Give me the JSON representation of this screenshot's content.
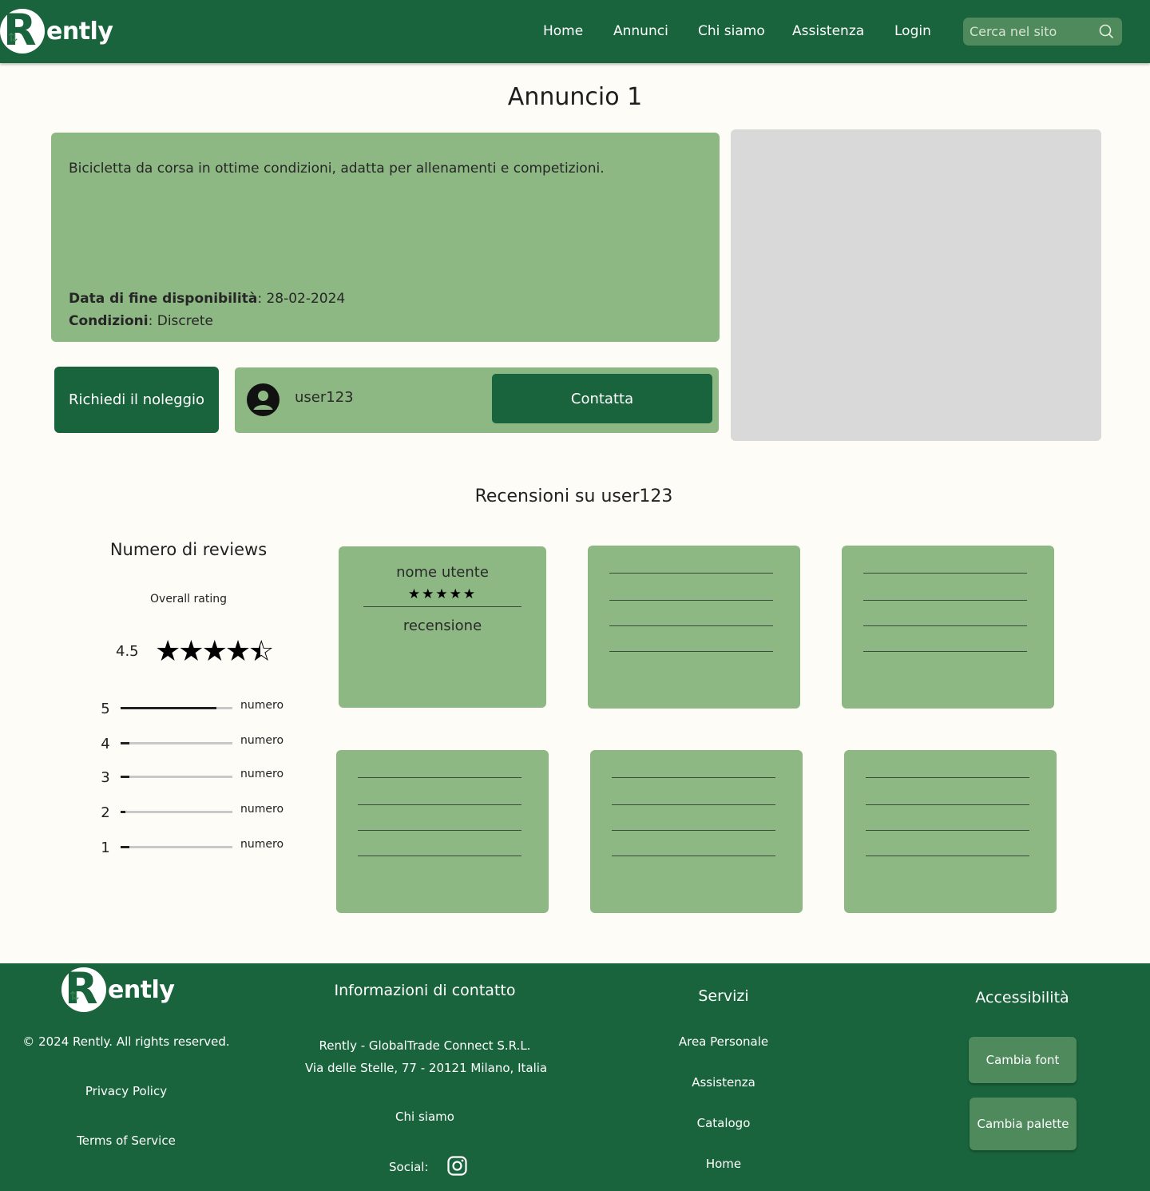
{
  "header": {
    "logo_text": "ently",
    "nav": [
      "Home",
      "Annunci",
      "Chi siamo",
      "Assistenza",
      "Login"
    ],
    "search_placeholder": "Cerca nel sito"
  },
  "listing": {
    "title": "Annuncio 1",
    "description": "Bicicletta da corsa in ottime condizioni, adatta per allenamenti e competizioni.",
    "end_date_label": "Data di fine disponibilità",
    "end_date_value": ": 28-02-2024",
    "condition_label": "Condizioni",
    "condition_value": ": Discrete",
    "rent_button": "Richiedi il noleggio",
    "owner_name": "user123",
    "contact_button": "Contatta"
  },
  "reviews": {
    "title": "Recensioni su user123",
    "stats_title": "Numero di reviews",
    "overall_label": "Overall rating",
    "average": "4.5",
    "average_value": 4.5,
    "bars": [
      {
        "stars": "5",
        "fraction": 0.86,
        "label": "numero"
      },
      {
        "stars": "4",
        "fraction": 0.08,
        "label": "numero"
      },
      {
        "stars": "3",
        "fraction": 0.08,
        "label": "numero"
      },
      {
        "stars": "2",
        "fraction": 0.04,
        "label": "numero"
      },
      {
        "stars": "1",
        "fraction": 0.08,
        "label": "numero"
      }
    ],
    "sample_card": {
      "user": "nome utente",
      "stars": "★★★★★",
      "text": "recensione"
    }
  },
  "footer": {
    "logo_text": "ently",
    "copyright": "© 2024 Rently. All rights reserved.",
    "privacy": "Privacy Policy",
    "terms": "Terms of Service",
    "contact_title": "Informazioni di contatto",
    "company": "Rently - GlobalTrade Connect S.R.L.",
    "address": "Via delle Stelle, 77 - 20121 Milano, Italia",
    "about": "Chi siamo",
    "social_label": "Social:",
    "services_title": "Servizi",
    "services": [
      "Area Personale",
      "Assistenza",
      "Catalogo",
      "Home"
    ],
    "access_title": "Accessibilità",
    "font_button": "Cambia font",
    "palette_button": "Cambia palette"
  },
  "colors": {
    "brand_green": "#19643d",
    "card_green": "#8db883",
    "button_green": "#4f8a5c",
    "background": "#fdfcf6"
  }
}
